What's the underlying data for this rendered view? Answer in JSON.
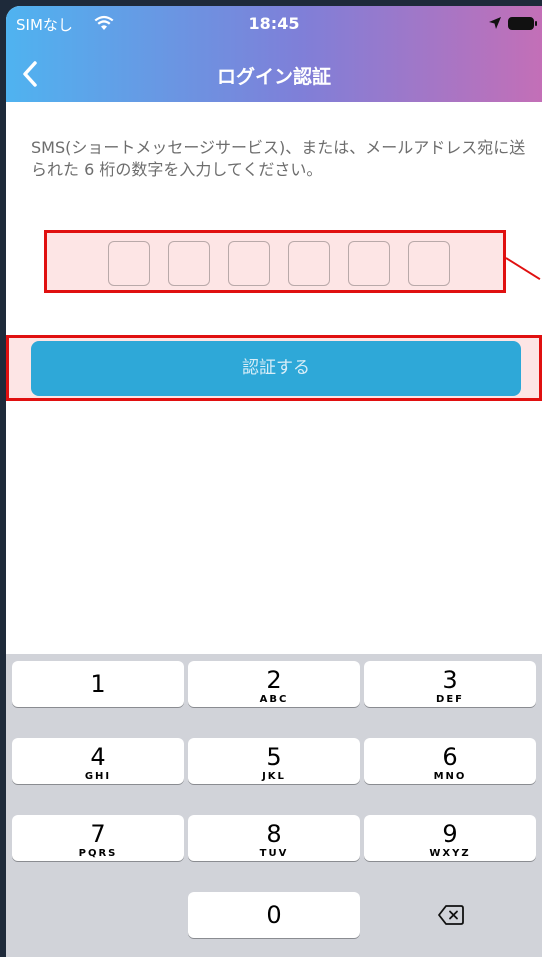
{
  "status_bar": {
    "carrier": "SIMなし",
    "time": "18:45"
  },
  "nav": {
    "title": "ログイン認証",
    "back_icon": "chevron-left-icon"
  },
  "instructions": "SMS(ショートメッセージサービス)、または、メールアドレス宛に送られた 6 桁の数字を入力してください。",
  "code_input": {
    "digits": 6
  },
  "submit": {
    "label": "認証する"
  },
  "keyboard": {
    "keys": [
      {
        "digit": "1",
        "letters": ""
      },
      {
        "digit": "2",
        "letters": "ABC"
      },
      {
        "digit": "3",
        "letters": "DEF"
      },
      {
        "digit": "4",
        "letters": "GHI"
      },
      {
        "digit": "5",
        "letters": "JKL"
      },
      {
        "digit": "6",
        "letters": "MNO"
      },
      {
        "digit": "7",
        "letters": "PQRS"
      },
      {
        "digit": "8",
        "letters": "TUV"
      },
      {
        "digit": "9",
        "letters": "WXYZ"
      },
      {
        "digit": "0",
        "letters": ""
      }
    ],
    "delete_icon": "backspace-icon"
  },
  "colors": {
    "accent": "#2ea8d8",
    "highlight": "#e01010"
  }
}
